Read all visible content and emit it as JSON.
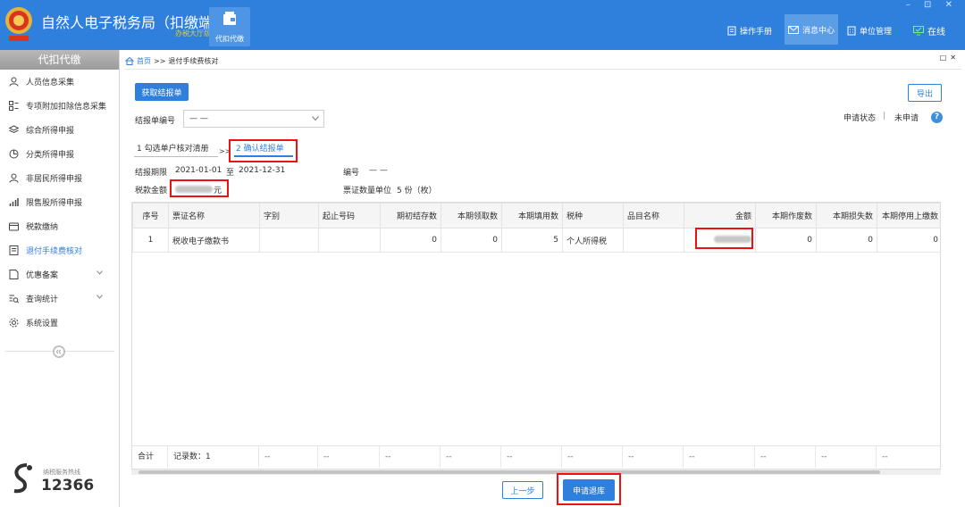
{
  "header": {
    "title": "自然人电子税务局（扣缴端）",
    "subtitle": "办税大厅版",
    "module_label": "代扣代缴",
    "nav": [
      {
        "label": "操作手册"
      },
      {
        "label": "消息中心"
      },
      {
        "label": "单位管理"
      },
      {
        "label": "在线"
      }
    ],
    "window_controls": "– ⊡ ✕"
  },
  "sidebar": {
    "title": "代扣代缴",
    "items": [
      {
        "label": "人员信息采集",
        "icon": "person-icon"
      },
      {
        "label": "专项附加扣除信息采集",
        "icon": "grid-icon"
      },
      {
        "label": "综合所得申报",
        "icon": "layers-icon"
      },
      {
        "label": "分类所得申报",
        "icon": "pie-icon"
      },
      {
        "label": "非居民所得申报",
        "icon": "person-alt-icon"
      },
      {
        "label": "限售股所得申报",
        "icon": "bar-chart-icon"
      },
      {
        "label": "税款缴纳",
        "icon": "wallet-icon"
      },
      {
        "label": "退付手续费核对",
        "icon": "document-check-icon",
        "active": true
      },
      {
        "label": "优惠备案",
        "icon": "document-icon",
        "expandable": true
      },
      {
        "label": "查询统计",
        "icon": "search-list-icon",
        "expandable": true
      },
      {
        "label": "系统设置",
        "icon": "gear-icon"
      }
    ],
    "hotline_label": "纳税服务热线",
    "hotline_number": "12366"
  },
  "breadcrumb": {
    "home": "首页",
    "sep": ">>",
    "current": "退付手续费核对"
  },
  "toolbar": {
    "get_report": "获取结报单",
    "export": "导出"
  },
  "form": {
    "report_no_label": "结报单编号",
    "report_no_value": "— —",
    "apply_status_label": "申请状态",
    "apply_status_sep": "|",
    "apply_status_value": "未申请",
    "help": "?"
  },
  "steps": {
    "step1": "1 勾选单户核对清册",
    "arrow": ">>",
    "step2": "2 确认结报单"
  },
  "info": {
    "period_label": "结报期限",
    "period_start": "2021-01-01",
    "period_to": "至",
    "period_end": "2021-12-31",
    "number_label": "编号",
    "number_value": "— —",
    "tax_amount_label": "税款金额",
    "tax_amount_unit": "元",
    "ticket_unit_label": "票证数量单位",
    "ticket_unit_value": "5 份（枚）"
  },
  "table": {
    "columns": [
      "序号",
      "票证名称",
      "字别",
      "起止号码",
      "期初结存数",
      "本期领取数",
      "本期填用数",
      "税种",
      "品目名称",
      "金额",
      "本期作废数",
      "本期损失数",
      "本期停用上缴数"
    ],
    "rows": [
      [
        "1",
        "税收电子缴款书",
        "",
        "",
        "0",
        "0",
        "5",
        "个人所得税",
        "",
        "",
        "0",
        "0",
        "0"
      ]
    ],
    "footer": {
      "total_label": "合计",
      "records": "记录数：1",
      "dash": "--"
    }
  },
  "actions": {
    "prev": "上一步",
    "apply": "申请退库"
  },
  "colors": {
    "primary": "#2f7fdc",
    "highlight": "#e11111",
    "subtitle": "#f6c343"
  }
}
